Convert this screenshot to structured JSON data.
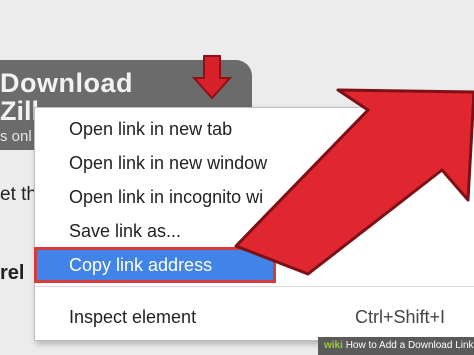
{
  "background_page": {
    "banner_line1": "Download",
    "banner_line2": "Zill",
    "banner_sub": "s onl",
    "text_line1": "et th",
    "text_line2": "rel"
  },
  "context_menu": {
    "items": [
      {
        "label": "Open link in new tab"
      },
      {
        "label": "Open link in new window"
      },
      {
        "label": "Open link in incognito wi"
      },
      {
        "label": "Save link as..."
      },
      {
        "label": "Copy link address"
      },
      {
        "label": "Inspect element",
        "shortcut": "Ctrl+Shift+I"
      }
    ],
    "selected_index": 4
  },
  "footer": {
    "brand": "wiki",
    "title": "How to Add a Download Link"
  },
  "colors": {
    "highlight": "#4183e6",
    "arrow_red": "#e0262f",
    "banner_gray": "#6b6b6b"
  }
}
